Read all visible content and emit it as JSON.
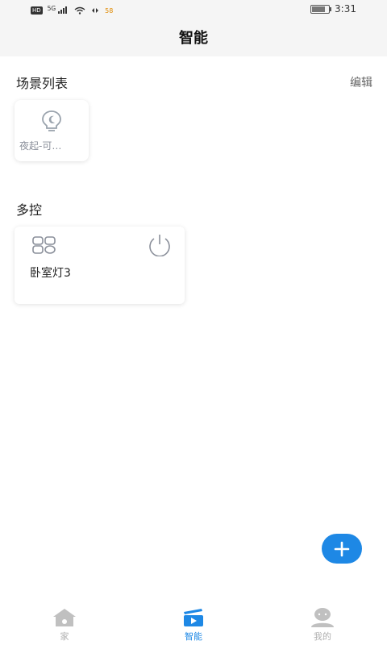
{
  "status": {
    "network": "HD",
    "signal": "5G",
    "speed": "58",
    "time": "3:31"
  },
  "header": {
    "title": "智能"
  },
  "scenes": {
    "title": "场景列表",
    "edit_label": "编辑",
    "items": [
      {
        "label": "夜起-可…",
        "icon": "night-bulb-icon"
      }
    ]
  },
  "multi": {
    "title": "多控",
    "devices": [
      {
        "name": "卧室灯3",
        "icon": "grid-icon",
        "action_icon": "power-icon"
      }
    ]
  },
  "fab": {
    "icon": "plus-icon"
  },
  "tabs": [
    {
      "label": "家",
      "icon": "home-icon",
      "active": false
    },
    {
      "label": "智能",
      "icon": "smart-icon",
      "active": true
    },
    {
      "label": "我的",
      "icon": "profile-icon",
      "active": false
    }
  ],
  "colors": {
    "accent": "#1e88e5",
    "inactive": "#c0c0c0"
  }
}
